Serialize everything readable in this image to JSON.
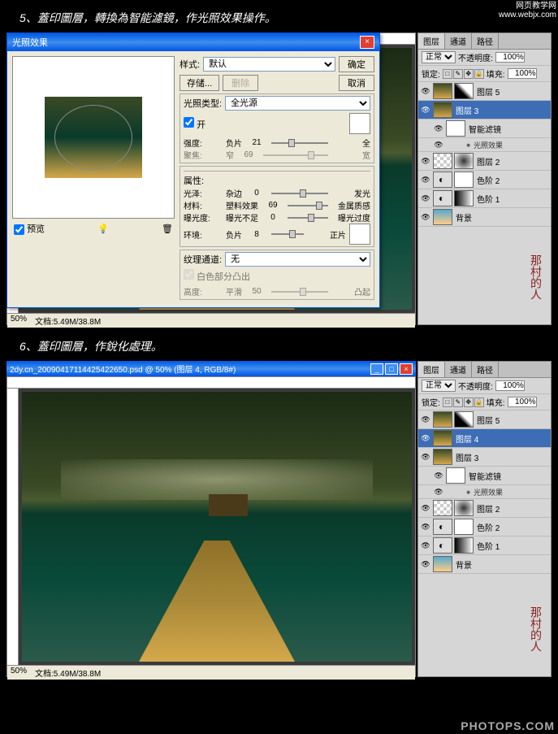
{
  "watermark_top": {
    "line1": "网页教学网",
    "line2": "www.webjx.com"
  },
  "watermark_bottom": "PHOTOPS.COM",
  "step5": {
    "label": "5、蓋印圖層，轉換為智能濾鏡，作光照效果操作。",
    "zoom": "50%",
    "doc_info": "文档:5.49M/38.8M"
  },
  "step6": {
    "label": "6、蓋印圖層，作銳化處理。",
    "titlebar": "2dy.cn_20090417114425422650.psd @ 50% (图层 4, RGB/8#)",
    "zoom": "50%",
    "doc_info": "文档:5.49M/38.8M"
  },
  "dialog": {
    "title": "光照效果",
    "preview_label": "预览",
    "buttons": {
      "ok": "确定",
      "cancel": "取消",
      "save": "存储...",
      "delete": "删除"
    },
    "style_label": "样式:",
    "style_value": "默认",
    "light_type_label": "光照类型:",
    "light_type_value": "全光源",
    "on_label": "开",
    "intensity": {
      "label": "强度:",
      "left": "负片",
      "value": "21",
      "right": "全"
    },
    "focus": {
      "label": "聚焦:",
      "left": "窄",
      "value": "69",
      "right": "宽"
    },
    "properties_label": "属性:",
    "gloss": {
      "label": "光泽:",
      "left": "杂边",
      "value": "0",
      "right": "发光"
    },
    "material": {
      "label": "材料:",
      "left": "塑料效果",
      "value": "69",
      "right": "金属质感"
    },
    "exposure": {
      "label": "曝光度:",
      "left": "曝光不足",
      "value": "0",
      "right": "曝光过度"
    },
    "ambience": {
      "label": "环境:",
      "left": "负片",
      "value": "8",
      "right": "正片"
    },
    "texture_label": "纹理通道:",
    "texture_value": "无",
    "white_high_label": "白色部分凸出",
    "height": {
      "label": "高度:",
      "left": "平滑",
      "value": "50",
      "right": "凸起"
    }
  },
  "layers_panel": {
    "tabs": [
      "图层",
      "通道",
      "路径"
    ],
    "blend_mode": "正常",
    "opacity_label": "不透明度:",
    "opacity_value": "100%",
    "lock_label": "锁定:",
    "fill_label": "填充:",
    "fill_value": "100%"
  },
  "layers5": [
    {
      "name": "图层 5",
      "type": "img-mask",
      "visible": true
    },
    {
      "name": "图层 3",
      "type": "img",
      "visible": true,
      "selected": true
    },
    {
      "name": "智能滤镜",
      "type": "smart",
      "visible": true,
      "nested": true
    },
    {
      "name": "光照效果",
      "type": "fx",
      "visible": true,
      "nested": true
    },
    {
      "name": "图层 2",
      "type": "checker-mask",
      "visible": true
    },
    {
      "name": "色阶 2",
      "type": "adj-mask",
      "visible": true
    },
    {
      "name": "色阶 1",
      "type": "adj-grad",
      "visible": true
    },
    {
      "name": "背景",
      "type": "bg",
      "visible": true
    }
  ],
  "layers6": [
    {
      "name": "图层 5",
      "type": "img-mask",
      "visible": true
    },
    {
      "name": "图层 4",
      "type": "img",
      "visible": true,
      "selected": true
    },
    {
      "name": "图层 3",
      "type": "img",
      "visible": true
    },
    {
      "name": "智能滤镜",
      "type": "smart",
      "visible": true,
      "nested": true
    },
    {
      "name": "光照效果",
      "type": "fx",
      "visible": true,
      "nested": true
    },
    {
      "name": "图层 2",
      "type": "checker-mask",
      "visible": true
    },
    {
      "name": "色阶 2",
      "type": "adj-mask",
      "visible": true
    },
    {
      "name": "色阶 1",
      "type": "adj-grad",
      "visible": true
    },
    {
      "name": "背景",
      "type": "bg",
      "visible": true
    }
  ],
  "signature": "那村的人"
}
